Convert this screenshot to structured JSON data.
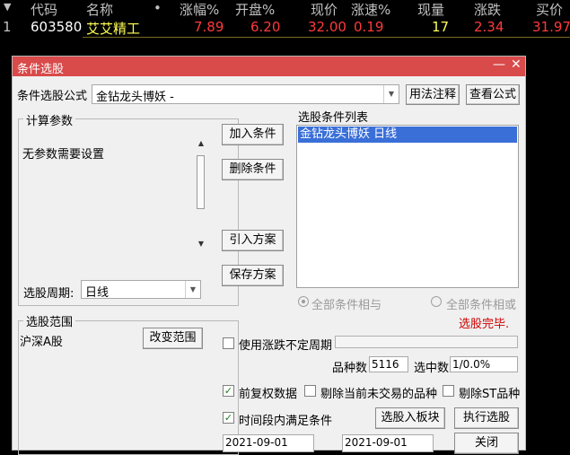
{
  "stock_table": {
    "headers": {
      "code": "代码",
      "name": "名称",
      "dot": "•",
      "change_pct": "涨幅%",
      "open_pct": "开盘%",
      "price": "现价",
      "speed": "涨速%",
      "volume": "现量",
      "change": "涨跌",
      "bid": "买价"
    },
    "row": {
      "index": "1",
      "code": "603580",
      "name": "艾艾精工",
      "change_pct": "7.89",
      "open_pct": "6.20",
      "price": "32.00",
      "speed": "0.19",
      "volume": "17",
      "change": "2.34",
      "bid": "31.97"
    },
    "colors": {
      "header": "#c0c0c0",
      "up": "#ff3a3a",
      "code": "#ffffff",
      "name": "#ffff55"
    }
  },
  "dialog": {
    "title": "条件选股",
    "minimize_glyph": "—",
    "close_glyph": "✕",
    "formula_label": "条件选股公式",
    "formula_value": "金钻龙头博妖 -",
    "usage_notes_button": "用法注释",
    "view_formula_button": "查看公式",
    "params_group_title": "计算参数",
    "params_text": "无参数需要设置",
    "add_condition_button": "加入条件",
    "delete_condition_button": "删除条件",
    "import_plan_button": "引入方案",
    "save_plan_button": "保存方案",
    "conditions_list_title": "选股条件列表",
    "conditions": [
      {
        "label": "金钻龙头博妖   日线"
      }
    ],
    "period_label": "选股周期:",
    "period_value": "日线",
    "logic_and": "全部条件相与",
    "logic_or": "全部条件相或",
    "status_text": "选股完毕.",
    "range_group_title": "选股范围",
    "range_value": "沪深A股",
    "change_range_button": "改变范围",
    "use_unfixed_period": "使用涨跌不定周期",
    "total_label": "品种数",
    "total_value": "5116",
    "selected_label": "选中数",
    "selected_value": "1/0.0%",
    "pre_adjust_label": "前复权数据",
    "exclude_untraded_label": "剔除当前未交易的品种",
    "exclude_st_label": "剔除ST品种",
    "time_range_label": "时间段内满足条件",
    "to_board_button": "选股入板块",
    "execute_button": "执行选股",
    "close_button": "关闭",
    "start_date": "2021-09-01",
    "end_date": "2021-09-01",
    "accent_color": "#d94a4a",
    "selection_color": "#3a6fd8",
    "status_color": "#cc0000"
  }
}
